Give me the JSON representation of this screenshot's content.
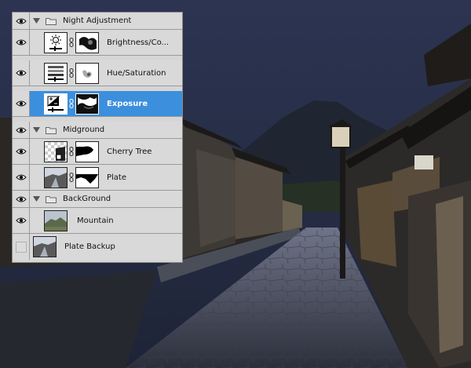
{
  "panel": {
    "layers": [
      {
        "kind": "group",
        "name": "Night Adjustment",
        "visible": true
      },
      {
        "kind": "adjustment",
        "name": "Brightness/Co...",
        "icon": "brightness-contrast-icon",
        "visible": true
      },
      {
        "kind": "adjustment",
        "name": "Hue/Saturation",
        "icon": "hue-saturation-icon",
        "visible": true
      },
      {
        "kind": "adjustment",
        "name": "Exposure",
        "icon": "exposure-icon",
        "visible": true,
        "selected": true
      },
      {
        "kind": "group",
        "name": "Midground",
        "visible": true
      },
      {
        "kind": "layer",
        "name": "Cherry Tree",
        "visible": true
      },
      {
        "kind": "layer",
        "name": "Plate",
        "visible": true
      },
      {
        "kind": "group",
        "name": "BackGround",
        "visible": true
      },
      {
        "kind": "layer",
        "name": "Mountain",
        "visible": true
      },
      {
        "kind": "layer",
        "name": "Plate Backup",
        "visible": false
      }
    ]
  },
  "colors": {
    "selected_row": "#3c8fdc",
    "panel_bg": "#d9d9d9",
    "sky": "#2a3350"
  }
}
